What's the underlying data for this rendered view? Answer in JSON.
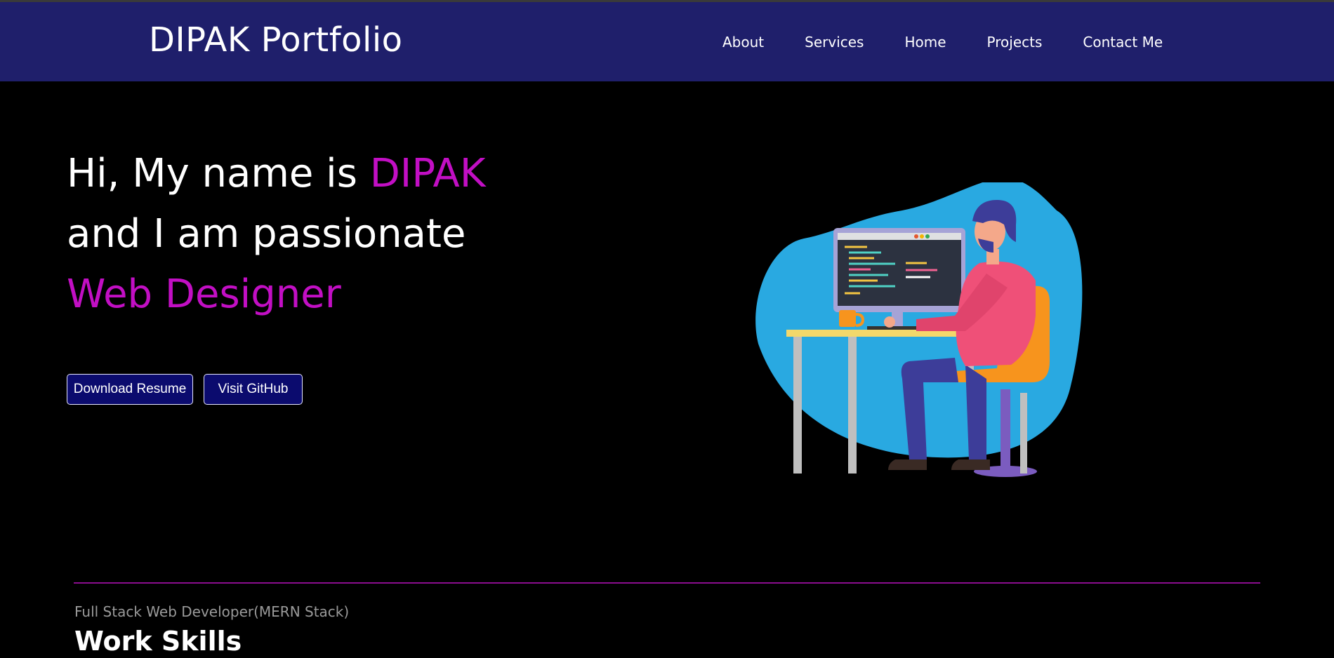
{
  "header": {
    "brand": "DIPAK Portfolio",
    "nav": [
      "About",
      "Services",
      "Home",
      "Projects",
      "Contact Me"
    ]
  },
  "hero": {
    "greeting": "Hi, My name is ",
    "name": "DIPAK",
    "line2": "and I am passionate",
    "role": "Web Designer",
    "buttons": {
      "resume": "Download Resume",
      "github": "Visit GitHub"
    }
  },
  "skills": {
    "subtitle": "Full Stack Web Developer(MERN Stack)",
    "title": "Work Skills"
  },
  "colors": {
    "navbar": "#1f1f6b",
    "accent": "#c20fc4",
    "button": "#0b0b6e",
    "background": "#000000"
  },
  "icons": [
    "developer-at-desk-illustration"
  ]
}
